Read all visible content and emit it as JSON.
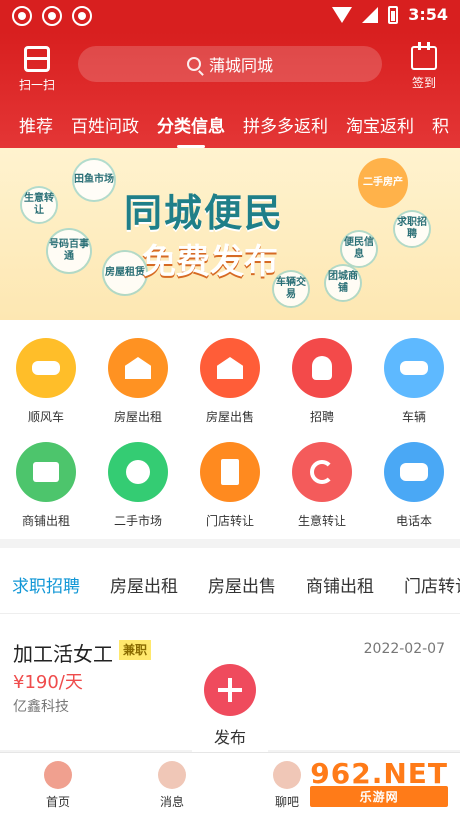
{
  "status": {
    "time": "3:54"
  },
  "header": {
    "scan_label": "扫一扫",
    "search_text": "蒲城同城",
    "checkin_label": "签到",
    "tabs": [
      "推荐",
      "百姓问政",
      "分类信息",
      "拼多多返利",
      "淘宝返利",
      "积"
    ]
  },
  "banner": {
    "title_top": "同城便民",
    "title_bottom": "免费发布",
    "tags": [
      "田鱼市场",
      "二手房产",
      "生意转让",
      "号码百事通",
      "房屋租赁",
      "求职招聘",
      "便民信息",
      "车辆交易",
      "团城商铺"
    ]
  },
  "quick_icons": [
    {
      "label": "顺风车"
    },
    {
      "label": "房屋出租"
    },
    {
      "label": "房屋出售"
    },
    {
      "label": "招聘"
    },
    {
      "label": "车辆"
    },
    {
      "label": "商铺出租"
    },
    {
      "label": "二手市场"
    },
    {
      "label": "门店转让"
    },
    {
      "label": "生意转让"
    },
    {
      "label": "电话本"
    }
  ],
  "categories": [
    "求职招聘",
    "房屋出租",
    "房屋出售",
    "商铺出租",
    "门店转让"
  ],
  "listing": {
    "title": "加工活女工",
    "badge": "兼职",
    "salary": "¥190/天",
    "company": "亿鑫科技",
    "date": "2022-02-07"
  },
  "publish": {
    "label": "发布"
  },
  "bottom_nav": [
    "首页",
    "消息",
    "聊吧"
  ],
  "watermark": {
    "text": "962.NET",
    "subtext": "乐游网"
  }
}
